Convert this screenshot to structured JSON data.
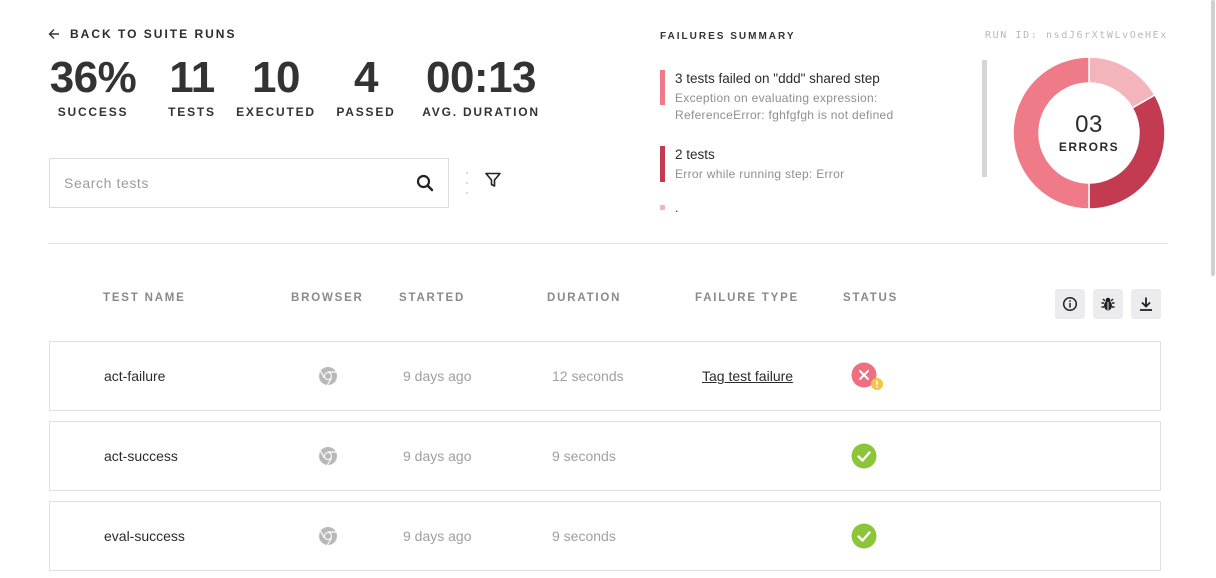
{
  "header": {
    "back_label": "BACK TO SUITE RUNS"
  },
  "stats": [
    {
      "value": "36%",
      "label": "SUCCESS"
    },
    {
      "value": "11",
      "label": "TESTS"
    },
    {
      "value": "10",
      "label": "EXECUTED"
    },
    {
      "value": "4",
      "label": "PASSED"
    },
    {
      "value": "00:13",
      "label": "AVG. DURATION"
    }
  ],
  "search": {
    "placeholder": "Search tests",
    "value": ""
  },
  "failures_summary": {
    "title": "FAILURES SUMMARY",
    "run_id": "RUN ID: nsdJ6rXtWLvOeHEx",
    "items": [
      {
        "title": "3 tests failed on \"ddd\" shared step",
        "description": "Exception on evaluating expression: ReferenceError: fghfgfgh is not defined",
        "color": "#f07b88"
      },
      {
        "title": "2 tests",
        "description": "Error while running step: Error",
        "color": "#c23b50"
      },
      {
        "title": ".",
        "description": "",
        "color": "#f4b4bc"
      }
    ]
  },
  "errors": {
    "count": "03",
    "label": "ERRORS",
    "segments": [
      {
        "value": 1,
        "color": "#f4b4bc"
      },
      {
        "value": 2,
        "color": "#c23b50"
      },
      {
        "value": 3,
        "color": "#f07b88"
      }
    ]
  },
  "table": {
    "columns": [
      "TEST NAME",
      "BROWSER",
      "STARTED",
      "DURATION",
      "FAILURE TYPE",
      "STATUS"
    ],
    "rows": [
      {
        "name": "act-failure",
        "browser": "chrome-icon",
        "started": "9 days ago",
        "duration": "12 seconds",
        "failure_type": "Tag test failure",
        "status": "failed"
      },
      {
        "name": "act-success",
        "browser": "chrome-icon",
        "started": "9 days ago",
        "duration": "9 seconds",
        "failure_type": "",
        "status": "passed"
      },
      {
        "name": "eval-success",
        "browser": "chrome-icon",
        "started": "9 days ago",
        "duration": "9 seconds",
        "failure_type": "",
        "status": "passed"
      }
    ]
  },
  "colors": {
    "fail": "#ee6f80",
    "pass": "#8cc43a",
    "warning": "#f4c542"
  }
}
